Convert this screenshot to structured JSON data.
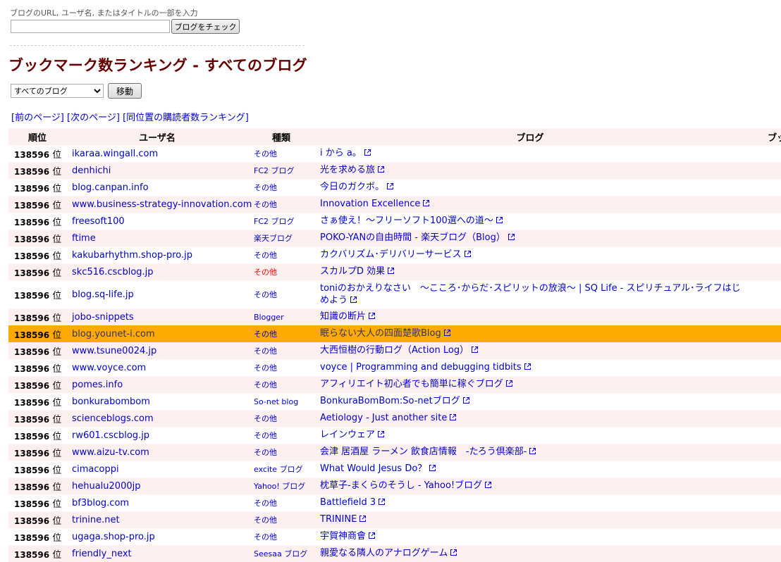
{
  "check": {
    "label": "ブログのURL, ユーザ名, またはタイトルの一部を入力",
    "input_value": "",
    "button": "ブログをチェック"
  },
  "page_title": "ブックマーク数ランキング - すべてのブログ",
  "category": {
    "selected": "すべてのブログ",
    "button": "移動"
  },
  "pager": {
    "prev": "[前のページ]",
    "next": "[次のページ]",
    "same_rank": "[同位置の購読者数ランキング]"
  },
  "table": {
    "headers": {
      "rank": "順位",
      "user": "ユーザ名",
      "type": "種類",
      "blog": "ブログ",
      "bookmarks": "ブック"
    },
    "rank_unit": "位",
    "rows": [
      {
        "rank": "138596",
        "user": "ikaraa.wingall.com",
        "type": "その他",
        "blog": "i から a。"
      },
      {
        "rank": "138596",
        "user": "denhichi",
        "type": "FC2 ブログ",
        "blog": "光を求める旅"
      },
      {
        "rank": "138596",
        "user": "blog.canpan.info",
        "type": "その他",
        "blog": "今日のガクボ。"
      },
      {
        "rank": "138596",
        "user": "www.business-strategy-innovation.com",
        "type": "その他",
        "blog": "Innovation Excellence"
      },
      {
        "rank": "138596",
        "user": "freesoft100",
        "type": "FC2 ブログ",
        "blog": "さぁ使え！～フリーソフト100選への道～"
      },
      {
        "rank": "138596",
        "user": "ftime",
        "type": "楽天ブログ",
        "blog": "POKO-YANの自由時間 - 楽天ブログ（Blog）"
      },
      {
        "rank": "138596",
        "user": "kakubarhythm.shop-pro.jp",
        "type": "その他",
        "blog": "カクバリズム･デリバリーサービス"
      },
      {
        "rank": "138596",
        "user": "skc516.cscblog.jp",
        "type": "その他",
        "blog": "スカルプD 効果",
        "type_red": true
      },
      {
        "rank": "138596",
        "user": "blog.sq-life.jp",
        "type": "その他",
        "blog": "toniのおかえりなさい　～こころ･からだ･スピリットの放浪～ | SQ Life - スピリチュアル･ライフはじめよう",
        "tall": true
      },
      {
        "rank": "138596",
        "user": "jobo-snippets",
        "type": "Blogger",
        "blog": "知識の断片"
      },
      {
        "rank": "138596",
        "user": "blog.younet-i.com",
        "type": "その他",
        "blog": "眠らない大人の四面楚歌Blog",
        "highlight": true
      },
      {
        "rank": "138596",
        "user": "www.tsune0024.jp",
        "type": "その他",
        "blog": "大西恒樹の行動ログ（Action Log）"
      },
      {
        "rank": "138596",
        "user": "www.voyce.com",
        "type": "その他",
        "blog": "voyce | Programming and debugging tidbits"
      },
      {
        "rank": "138596",
        "user": "pomes.info",
        "type": "その他",
        "blog": "アフィリエイト初心者でも簡単に稼ぐブログ"
      },
      {
        "rank": "138596",
        "user": "bonkurabombom",
        "type": "So-net blog",
        "blog": "BonkuraBomBom:So-netブログ"
      },
      {
        "rank": "138596",
        "user": "scienceblogs.com",
        "type": "その他",
        "blog": "Aetiology - Just another site"
      },
      {
        "rank": "138596",
        "user": "rw601.cscblog.jp",
        "type": "その他",
        "blog": "レインウェア"
      },
      {
        "rank": "138596",
        "user": "www.aizu-tv.com",
        "type": "その他",
        "blog": "会津 居酒屋 ラーメン 飲食店情報　-たろう倶楽部-"
      },
      {
        "rank": "138596",
        "user": "cimacoppi",
        "type": "excite ブログ",
        "blog": "What Would Jesus Do？"
      },
      {
        "rank": "138596",
        "user": "hehualu2000jp",
        "type": "Yahoo! ブログ",
        "blog": "枕草子-まくらのそうし - Yahoo!ブログ"
      },
      {
        "rank": "138596",
        "user": "bf3blog.com",
        "type": "その他",
        "blog": "Battlefield 3"
      },
      {
        "rank": "138596",
        "user": "trinine.net",
        "type": "その他",
        "blog": "TRININE"
      },
      {
        "rank": "138596",
        "user": "ugaga.shop-pro.jp",
        "type": "その他",
        "blog": "宇賀神商會"
      },
      {
        "rank": "138596",
        "user": "friendly_next",
        "type": "Seesaa ブログ",
        "blog": "親愛なる隣人のアナログゲーム"
      }
    ]
  },
  "colors": {
    "title": "#660000",
    "link": "#0000cc",
    "row_alt": "#fff0f0",
    "highlight": "#ffaa00",
    "type_red": "#ff0000"
  },
  "icons": {
    "external_link": "external-link-icon"
  }
}
